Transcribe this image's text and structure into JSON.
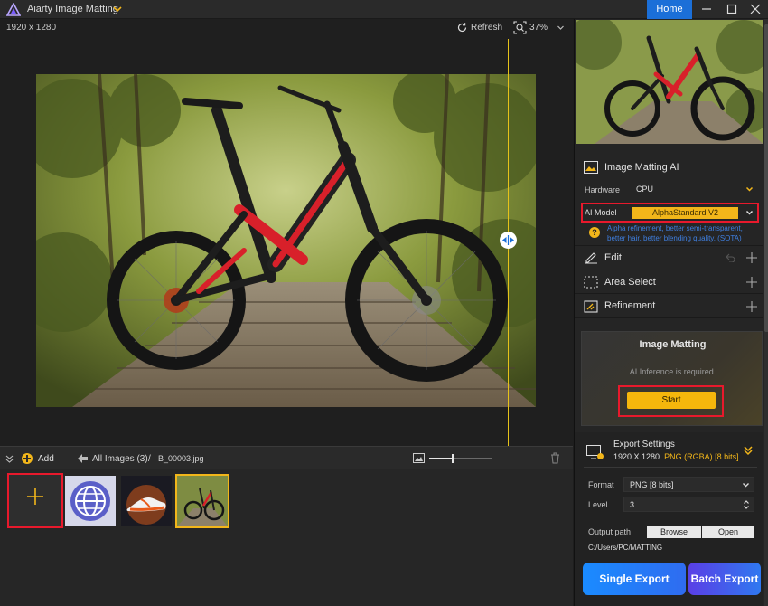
{
  "titlebar": {
    "app_title": "Aiarty Image Matting",
    "home_label": "Home"
  },
  "canvas": {
    "resolution": "1920 x 1280",
    "refresh_label": "Refresh",
    "zoom": "37%"
  },
  "panel": {
    "image_matting_ai": "Image Matting AI",
    "hardware_label": "Hardware",
    "hardware_value": "CPU",
    "ai_model_label": "AI Model",
    "ai_model_value": "AlphaStandard  V2",
    "ai_model_hint": "Alpha refinement, better semi-transparent, better hair, better blending quality. (SOTA)",
    "sections": [
      "Edit",
      "Area Select",
      "Refinement"
    ],
    "matting_card": {
      "title": "Image Matting",
      "subtitle": "AI Inference is required.",
      "start_label": "Start"
    },
    "export": {
      "title": "Export Settings",
      "resolution": "1920 X 1280",
      "format_summary": "PNG (RGBA) [8 bits]",
      "format_label": "Format",
      "format_value": "PNG  [8 bits]",
      "level_label": "Level",
      "level_value": "3",
      "output_path_label": "Output path",
      "browse_label": "Browse",
      "open_label": "Open",
      "output_path": "C:/Users/PC/MATTING",
      "single_export_label": "Single Export",
      "batch_export_label": "Batch Export"
    }
  },
  "filmstrip": {
    "add_label": "Add",
    "crumb_all": "All Images (3)",
    "crumb_sep": "/",
    "crumb_file": "B_00003.jpg",
    "thumbnail_size_percent": 37
  },
  "colors": {
    "accent_yellow": "#f2b61a",
    "highlight_red": "#e8192c",
    "home_blue": "#1b6fd8",
    "hint_blue": "#3f7fe0"
  }
}
